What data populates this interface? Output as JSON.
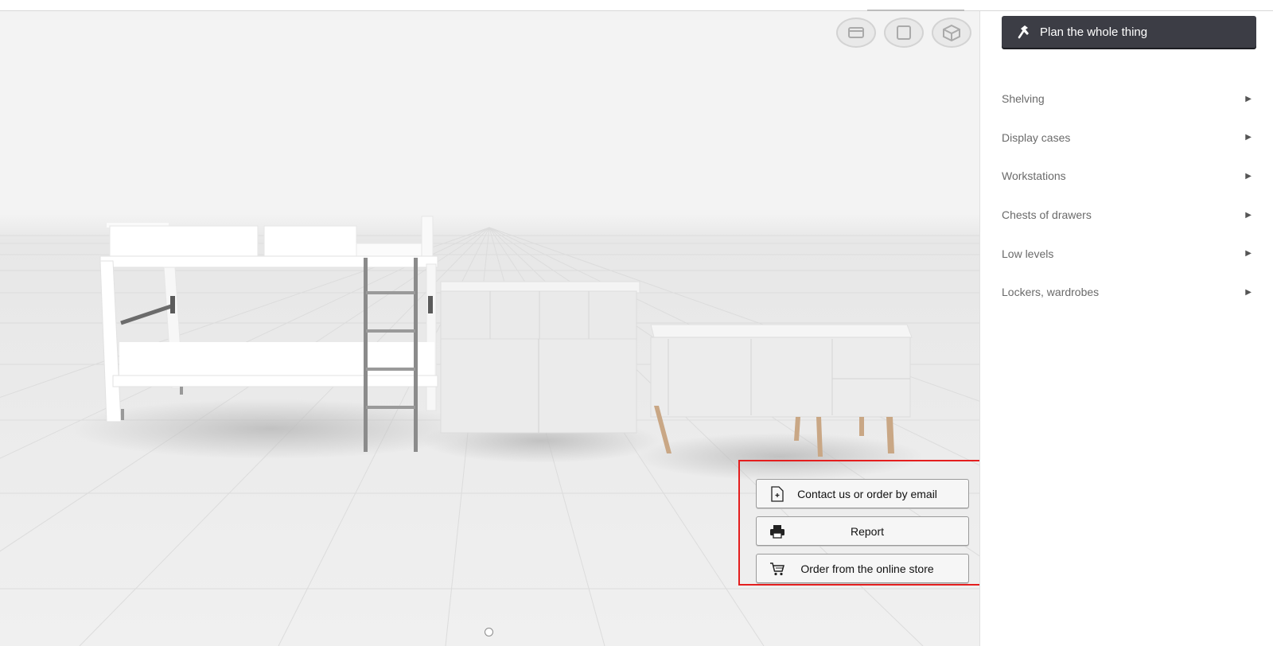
{
  "toolbar": {
    "view_buttons": [
      "top-view-icon",
      "front-view-icon",
      "3d-view-icon"
    ]
  },
  "actions": {
    "contact": {
      "label": "Contact us or order by email",
      "icon": "document-icon"
    },
    "report": {
      "label": "Report",
      "icon": "printer-icon"
    },
    "order": {
      "label": "Order from the online store",
      "icon": "cart-icon"
    },
    "highlight_color": "#e41e1e"
  },
  "sidebar": {
    "plan_button": {
      "label": "Plan the whole thing",
      "icon": "hammer-icon",
      "color": "#3c3d45"
    },
    "categories": [
      {
        "label": "Shelving"
      },
      {
        "label": "Display cases"
      },
      {
        "label": "Workstations"
      },
      {
        "label": "Chests of drawers"
      },
      {
        "label": "Low levels"
      },
      {
        "label": "Lockers, wardrobes"
      }
    ]
  }
}
